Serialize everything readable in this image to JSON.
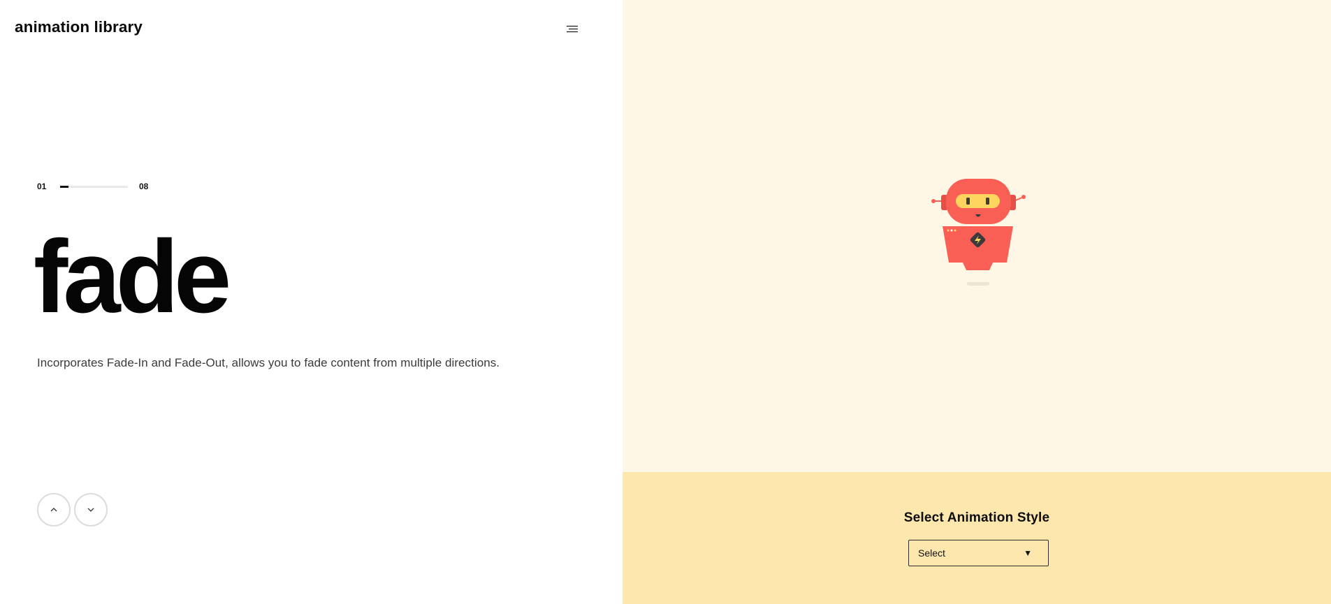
{
  "header": {
    "logo_text": "animation library",
    "menu_icon": "hamburger-menu-icon"
  },
  "slide": {
    "current": "01",
    "total": "08",
    "progress_fraction": 0.125,
    "title": "fade",
    "description": "Incorporates Fade-In and Fade-Out, allows you to fade content from multiple directions."
  },
  "navigation": {
    "prev_icon": "chevron-up-icon",
    "next_icon": "chevron-down-icon"
  },
  "preview": {
    "illustration": "robot-illustration",
    "colors": {
      "background": "#fef7e5",
      "robot_body": "#fa5f55",
      "visor": "#fed55f",
      "eyes": "#3b3b3b",
      "shadow": "#ede5d2"
    }
  },
  "animation_select": {
    "heading": "Select Animation Style",
    "selected_value": "Select",
    "arrow_glyph": "▼",
    "panel_color": "#fde7ad"
  }
}
